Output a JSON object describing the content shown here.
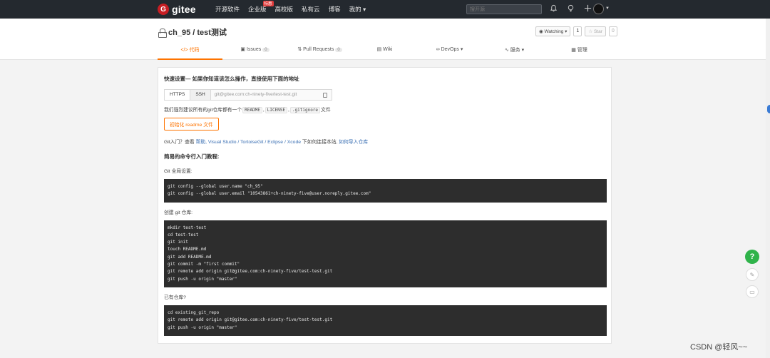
{
  "brand": {
    "logo_letter": "G",
    "name": "gitee"
  },
  "nav": {
    "links": [
      "开源软件",
      "企业版",
      "高校版",
      "私有云",
      "博客",
      "我的 ▾"
    ],
    "badge": "特惠",
    "search_placeholder": "搜开源"
  },
  "repo": {
    "title": "ch_95 / test测试",
    "watch_label": "Watching ▾",
    "watch_count": "1",
    "star_label": "☆ Star",
    "star_count": "0"
  },
  "tabs": [
    {
      "label": "</> 代码",
      "count": ""
    },
    {
      "label": "Issues",
      "count": "0"
    },
    {
      "label": "Pull Requests",
      "count": "0"
    },
    {
      "label": "Wiki",
      "count": ""
    },
    {
      "label": "DevOps ▾",
      "count": ""
    },
    {
      "label": "服务 ▾",
      "count": ""
    },
    {
      "label": "管理",
      "count": ""
    }
  ],
  "quick": {
    "heading": "快速设置— 如果你知道该怎么操作，直接使用下面的地址",
    "https": "HTTPS",
    "ssh": "SSH",
    "url": "git@gitee.com:ch-ninety-five/test-test.git",
    "recommend_prefix": "我们强烈建议所有的git仓库都有一个",
    "readme": "README",
    "license": "LICENSE",
    "gitignore": ".gitignore",
    "recommend_suffix": "文件",
    "init_button": "初始化 readme 文件",
    "help_prefix": "Git入门？查看",
    "help_link": "帮助",
    "help_tools": ", Visual Studio / TortoiseGit / Eclipse / Xcode",
    "help_mid": "下如何连接本站,",
    "help_import": "如何导入仓库"
  },
  "tutorial": {
    "heading": "简易的命令行入门教程:",
    "global_label": "Git 全局设置:",
    "global_code": [
      "git config --global user.name \"ch_95\"",
      "git config --global user.email \"10543861+ch-ninety-five@user.noreply.gitee.com\""
    ],
    "create_label": "创建 git 仓库:",
    "create_code": [
      "mkdir test-test",
      "cd test-test",
      "git init",
      "touch README.md",
      "git add README.md",
      "git commit -m \"first commit\"",
      "git remote add origin git@gitee.com:ch-ninety-five/test-test.git",
      "git push -u origin \"master\""
    ],
    "existing_label": "已有仓库?",
    "existing_code": [
      "cd existing_git_repo",
      "git remote add origin git@gitee.com:ch-ninety-five/test-test.git",
      "git push -u origin \"master\""
    ]
  },
  "floating": {
    "help": "?"
  },
  "watermark": "CSDN @轻风~~"
}
